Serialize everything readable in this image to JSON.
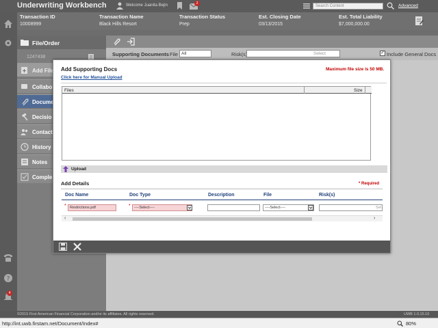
{
  "app": {
    "title": "Underwriting Workbench",
    "welcome": "Welcome Juanita Bejin",
    "mail_count": "2",
    "search_placeholder": "Search Content",
    "advanced": "Advanced"
  },
  "transaction": {
    "columns": [
      {
        "header": "Transaction ID",
        "value": "10008999"
      },
      {
        "header": "Transaction Name",
        "value": "Black Hills Resort"
      },
      {
        "header": "Transaction Status",
        "value": "Prep"
      },
      {
        "header": "Est. Closing Date",
        "value": "03/13/2015"
      },
      {
        "header": "Est. Total Liability",
        "value": "$7,000,000.00"
      }
    ]
  },
  "sidebar": {
    "file_order": "File/Order",
    "order_number": "1247438",
    "items": [
      {
        "label": "Add File"
      },
      {
        "label": "Collabo"
      },
      {
        "label": "Docume"
      },
      {
        "label": "Decisio"
      },
      {
        "label": "Contact"
      },
      {
        "label": "History"
      },
      {
        "label": "Notes"
      },
      {
        "label": "Comple"
      }
    ]
  },
  "rail": {
    "notification_count": "4"
  },
  "filter": {
    "supporting_docs": "Supporting Documents",
    "file_label": "File",
    "file_value": "All",
    "risks_label": "Risk(s)",
    "risks_value": "Select",
    "include_general": "Include General Docs"
  },
  "modal": {
    "title": "Add Supporting Docs",
    "max_size": "Maximum file size is 50 MB.",
    "manual_upload": "Click here for Manual Upload",
    "files_col": "Files",
    "size_col": "Size",
    "upload": "Upload",
    "add_details": "Add Details",
    "required": "* Required",
    "headers": {
      "doc_name": "Doc Name",
      "doc_type": "Doc Type",
      "description": "Description",
      "file": "File",
      "risks": "Risk(s)"
    },
    "row": {
      "doc_name": "Restrictions.pdf",
      "doc_type": "----Select----",
      "description": "",
      "file": "----Select----",
      "risks": "Sel"
    }
  },
  "footer": {
    "copyright": "©2015 First American Financial Corporation and/or its affiliates. All rights reserved.",
    "version": "UWB 1.0.15.10"
  },
  "statusbar": {
    "url": "http://int.uwb.firstam.net/Document/Index#",
    "zoom": "80%"
  }
}
